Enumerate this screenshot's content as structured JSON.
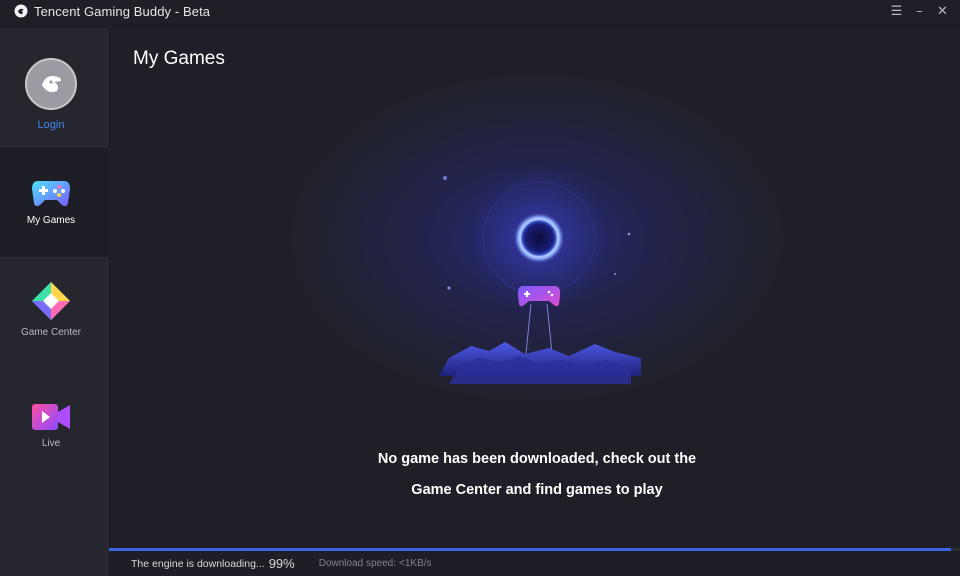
{
  "window": {
    "title": "Tencent Gaming Buddy - Beta",
    "controls": {
      "menu": "☰",
      "minimize": "–",
      "close": "✕"
    }
  },
  "sidebar": {
    "login_label": "Login",
    "items": [
      {
        "label": "My Games",
        "icon": "gamepad-icon",
        "active": true
      },
      {
        "label": "Game Center",
        "icon": "game-center-icon",
        "active": false
      },
      {
        "label": "Live",
        "icon": "live-video-icon",
        "active": false
      }
    ]
  },
  "main": {
    "title": "My Games",
    "empty_message_line1": "No game has been downloaded, check out the",
    "empty_message_line2": "Game Center and find games to play"
  },
  "status": {
    "engine_text": "The engine is downloading...",
    "percent": "99%",
    "progress": 0.99,
    "speed_label": "Download speed:",
    "speed_value": "<1KB/s"
  },
  "colors": {
    "accent": "#3e88f2",
    "progress": "#3a66e6",
    "background": "#1e1f26",
    "sidebar": "#25262e"
  }
}
